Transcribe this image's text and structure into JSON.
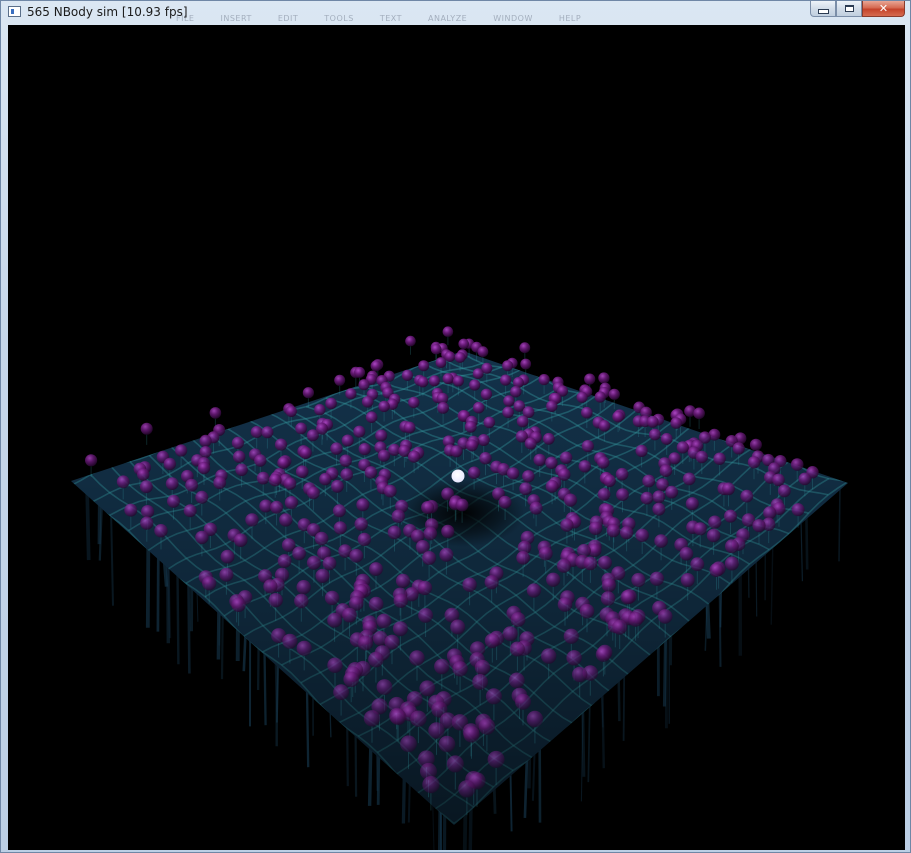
{
  "window": {
    "title": "565 NBody sim [10.93 fps]",
    "ghost_menu": [
      "FILE",
      "INSERT",
      "EDIT",
      "TOOLS",
      "TEXT",
      "ANALYZE",
      "WINDOW",
      "HELP"
    ],
    "buttons": {
      "minimize": "minimize",
      "maximize": "maximize",
      "close": "close"
    }
  },
  "scene": {
    "background_color": "#000000",
    "grid_color": "#3aa9b0",
    "surface_color": "#13324a",
    "particle_color": "#7a1e8a",
    "central_body_color": "#ffffff",
    "particle_count": 565
  }
}
